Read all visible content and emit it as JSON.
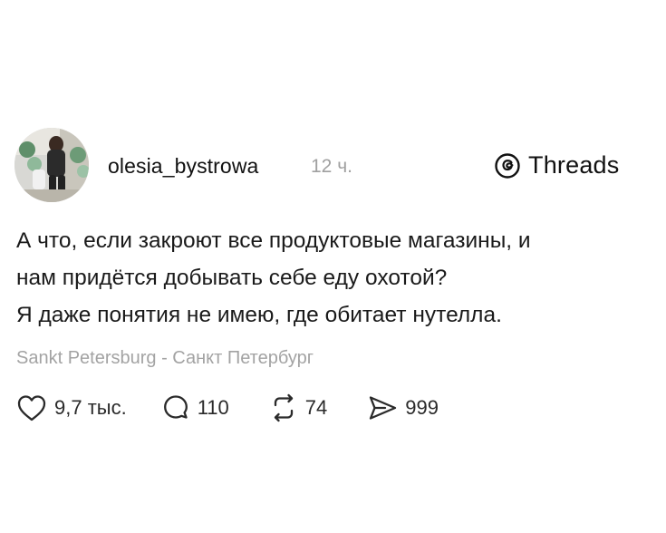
{
  "post": {
    "author": {
      "username": "olesia_bystrowa",
      "time": "12 ч."
    },
    "brand": {
      "name": "Threads",
      "icon": "threads-logo-icon"
    },
    "text_lines": [
      "А что, если закроют все продуктовые магазины, и",
      "нам придётся добывать себе еду охотой?",
      "Я даже понятия не имею, где обитает нутелла."
    ],
    "location": "Sankt Petersburg - Санкт Петербург",
    "actions": {
      "like": {
        "icon": "heart-icon",
        "count": "9,7 тыс."
      },
      "comment": {
        "icon": "comment-icon",
        "count": "110"
      },
      "repost": {
        "icon": "repost-icon",
        "count": "74"
      },
      "share": {
        "icon": "share-icon",
        "count": "999"
      }
    }
  }
}
